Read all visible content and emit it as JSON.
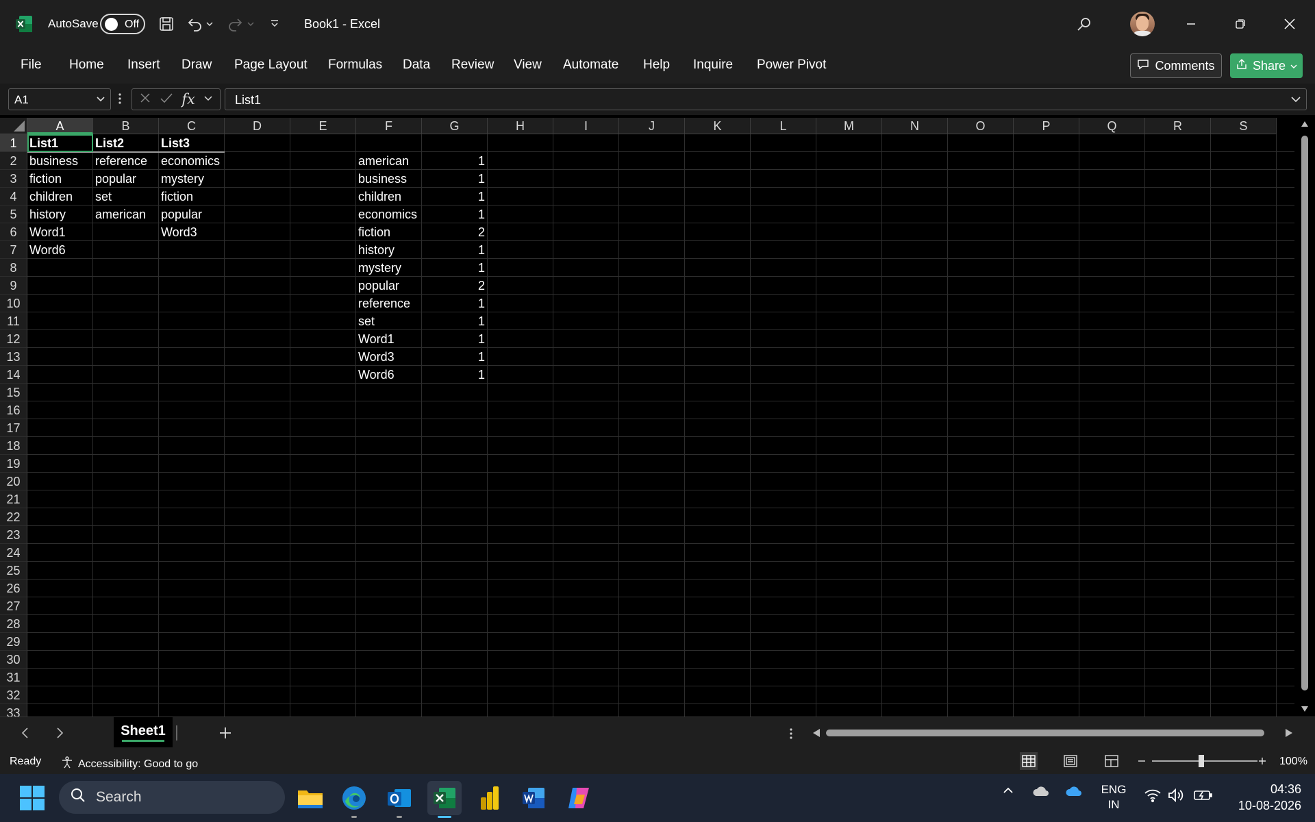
{
  "titlebar": {
    "autosave_label": "AutoSave",
    "autosave_state": "Off",
    "doc_title": "Book1  -  Excel"
  },
  "ribbon": {
    "tabs": [
      "File",
      "Home",
      "Insert",
      "Draw",
      "Page Layout",
      "Formulas",
      "Data",
      "Review",
      "View",
      "Automate",
      "Help",
      "Inquire",
      "Power Pivot"
    ],
    "comments_label": "Comments",
    "share_label": "Share"
  },
  "formula_bar": {
    "name_box": "A1",
    "formula": "List1"
  },
  "grid": {
    "columns": [
      "A",
      "B",
      "C",
      "D",
      "E",
      "F",
      "G",
      "H",
      "I",
      "J",
      "K",
      "L",
      "M",
      "N",
      "O",
      "P",
      "Q",
      "R",
      "S"
    ],
    "rows": [
      "1",
      "2",
      "3",
      "4",
      "5",
      "6",
      "7",
      "8",
      "9",
      "10",
      "11",
      "12",
      "13",
      "14",
      "15",
      "16",
      "17",
      "18",
      "19",
      "20",
      "21",
      "22",
      "23",
      "24",
      "25",
      "26",
      "27",
      "28",
      "29",
      "30",
      "31",
      "32",
      "33"
    ],
    "selected_cell": "A1",
    "headers": {
      "A1": "List1",
      "B1": "List2",
      "C1": "List3"
    },
    "list_cells": {
      "A2": "business",
      "A3": "fiction",
      "A4": "children",
      "A5": "history",
      "A6": "Word1",
      "A7": "Word6",
      "B2": "reference",
      "B3": "popular",
      "B4": "set",
      "B5": "american",
      "C2": "economics",
      "C3": "mystery",
      "C4": "fiction",
      "C5": "popular",
      "C6": "Word3"
    },
    "counts": [
      {
        "word": "american",
        "count": "1"
      },
      {
        "word": "business",
        "count": "1"
      },
      {
        "word": "children",
        "count": "1"
      },
      {
        "word": "economics",
        "count": "1"
      },
      {
        "word": "fiction",
        "count": "2"
      },
      {
        "word": "history",
        "count": "1"
      },
      {
        "word": "mystery",
        "count": "1"
      },
      {
        "word": "popular",
        "count": "2"
      },
      {
        "word": "reference",
        "count": "1"
      },
      {
        "word": "set",
        "count": "1"
      },
      {
        "word": "Word1",
        "count": "1"
      },
      {
        "word": "Word3",
        "count": "1"
      },
      {
        "word": "Word6",
        "count": "1"
      }
    ]
  },
  "sheets": {
    "tabs": [
      "Sheet1"
    ],
    "active": "Sheet1"
  },
  "status": {
    "ready": "Ready",
    "accessibility": "Accessibility: Good to go",
    "zoom": "100%"
  },
  "taskbar": {
    "search_placeholder": "Search",
    "lang_line1": "ENG",
    "lang_line2": "IN",
    "time": "04:36",
    "date": "10-08-2026"
  },
  "colors": {
    "accent_green": "#3aa768",
    "background": "#000000",
    "chrome": "#1f1f1f"
  }
}
